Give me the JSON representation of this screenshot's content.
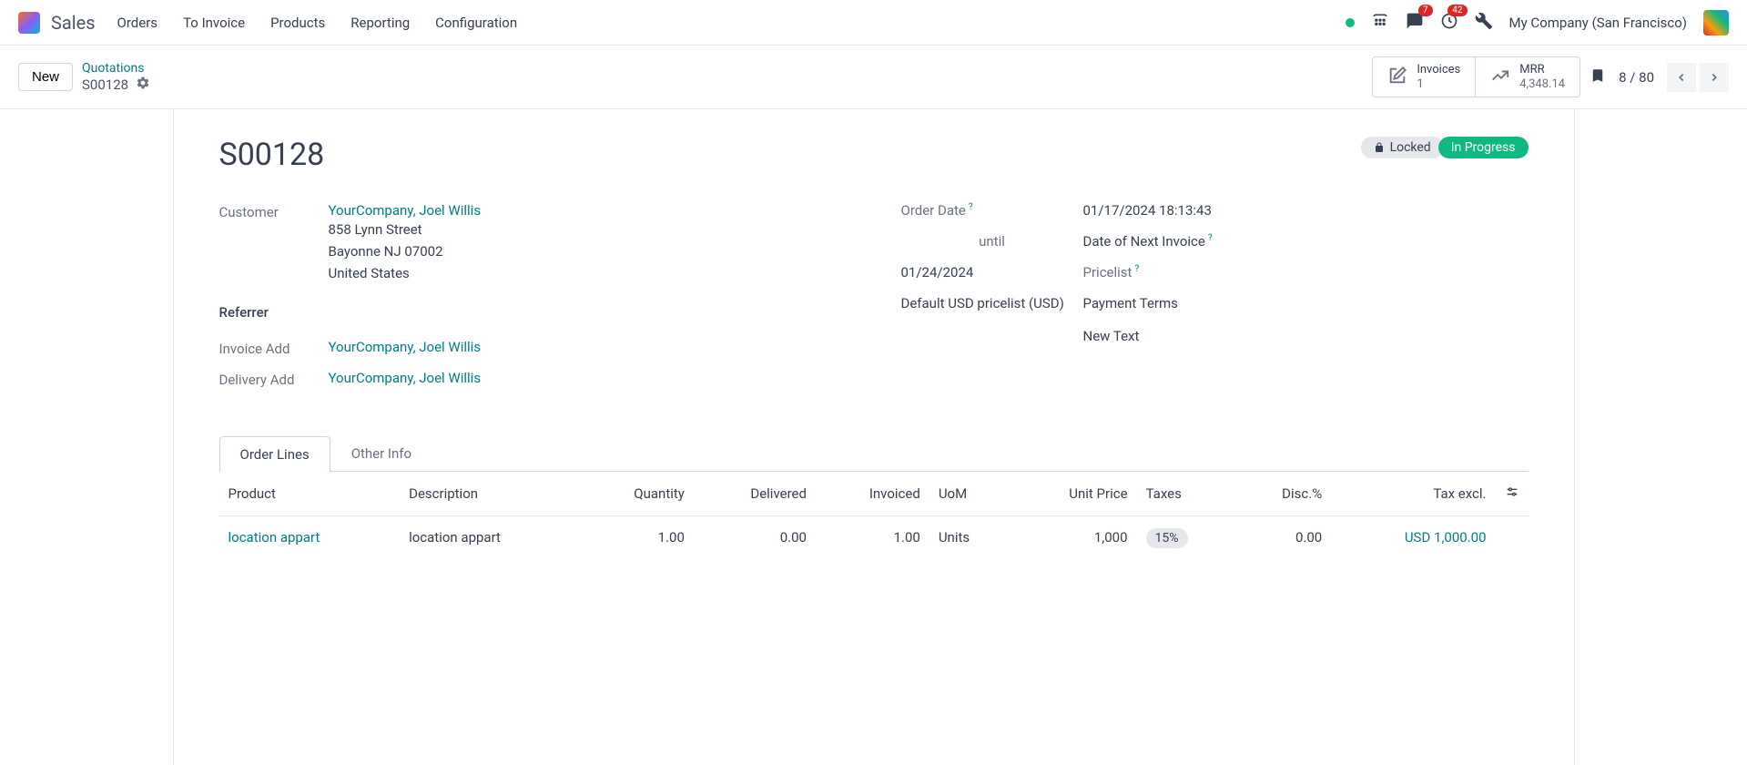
{
  "nav": {
    "brand": "Sales",
    "menu": [
      "Orders",
      "To Invoice",
      "Products",
      "Reporting",
      "Configuration"
    ],
    "msg_badge": "7",
    "activity_badge": "42",
    "company": "My Company (San Francisco)"
  },
  "crumb": {
    "new_btn": "New",
    "parent": "Quotations",
    "current": "S00128",
    "stats": {
      "invoices_label": "Invoices",
      "invoices_val": "1",
      "mrr_label": "MRR",
      "mrr_val": "4,348.14"
    },
    "pager": "8 / 80"
  },
  "sheet": {
    "title": "S00128",
    "locked": "Locked",
    "status": "In Progress",
    "left": {
      "customer_label": "Customer",
      "customer_link": "YourCompany, Joel Willis",
      "addr1": "858 Lynn Street",
      "addr2": "Bayonne NJ 07002",
      "addr3": "United States",
      "referrer_label": "Referrer",
      "invoice_label": "Invoice Add",
      "invoice_link": "YourCompany, Joel Willis",
      "delivery_label": "Delivery Add",
      "delivery_link": "YourCompany, Joel Willis"
    },
    "right": {
      "orderdate_label": "Order Date",
      "orderdate_val": "01/17/2024 18:13:43",
      "until_label": "until",
      "until_val": "Date of Next Invoice",
      "untildate": "01/24/2024",
      "pricelist_label": "Pricelist",
      "pricelist_val": "Default USD pricelist (USD)",
      "payment_label": "Payment Terms",
      "newtext": "New Text"
    },
    "tabs": {
      "orderlines": "Order Lines",
      "other": "Other Info"
    },
    "table": {
      "headers": {
        "product": "Product",
        "description": "Description",
        "quantity": "Quantity",
        "delivered": "Delivered",
        "invoiced": "Invoiced",
        "uom": "UoM",
        "unitprice": "Unit Price",
        "taxes": "Taxes",
        "disc": "Disc.%",
        "taxexcl": "Tax excl."
      },
      "rows": [
        {
          "product": "location appart",
          "description": "location appart",
          "quantity": "1.00",
          "delivered": "0.00",
          "invoiced": "1.00",
          "uom": "Units",
          "unitprice": "1,000",
          "taxes": "15%",
          "disc": "0.00",
          "taxexcl": "USD 1,000.00"
        }
      ]
    }
  }
}
